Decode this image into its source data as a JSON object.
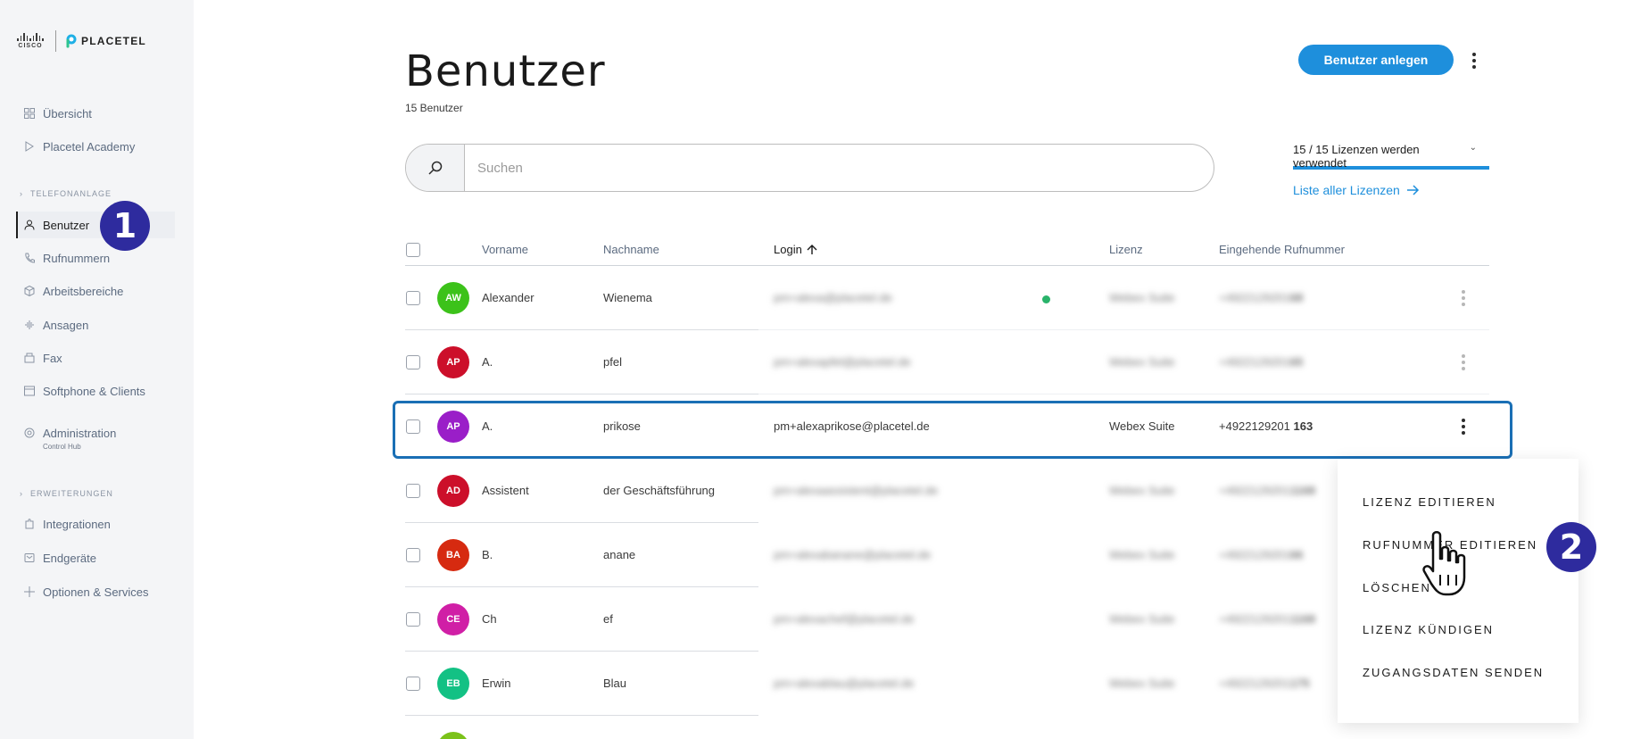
{
  "brand": {
    "cisco": "CISCO",
    "placetel": "PLACETEL"
  },
  "sidebar": {
    "items": [
      {
        "label": "Übersicht",
        "icon": "grid-icon"
      },
      {
        "label": "Placetel Academy",
        "icon": "play-icon"
      },
      {
        "label": "Benutzer",
        "icon": "user-icon"
      },
      {
        "label": "Rufnummern",
        "icon": "phone-icon"
      },
      {
        "label": "Arbeitsbereiche",
        "icon": "cube-icon"
      },
      {
        "label": "Ansagen",
        "icon": "waveform-icon"
      },
      {
        "label": "Fax",
        "icon": "fax-icon"
      },
      {
        "label": "Softphone & Clients",
        "icon": "window-icon"
      },
      {
        "label": "Administration",
        "icon": "gear-icon",
        "sub": "Control Hub"
      },
      {
        "label": "Integrationen",
        "icon": "puzzle-icon"
      },
      {
        "label": "Endgeräte",
        "icon": "device-icon"
      },
      {
        "label": "Optionen & Services",
        "icon": "plus-icon"
      }
    ],
    "sections": {
      "telefonanlage": "TELEFONANLAGE",
      "erweiterungen": "ERWEITERUNGEN"
    }
  },
  "annotations": {
    "step1": "1",
    "step2": "2"
  },
  "header": {
    "title": "Benutzer",
    "subtitle": "15 Benutzer",
    "create_button": "Benutzer anlegen"
  },
  "search": {
    "placeholder": "Suchen"
  },
  "licenses": {
    "usage": "15 / 15 Lizenzen werden verwendet",
    "link": "Liste aller Lizenzen"
  },
  "table": {
    "columns": {
      "vorname": "Vorname",
      "nachname": "Nachname",
      "login": "Login",
      "lizenz": "Lizenz",
      "rufnummer": "Eingehende Rufnummer"
    },
    "rows": [
      {
        "initials": "AW",
        "color": "#3cc21a",
        "vorname": "Alexander",
        "nachname": "Wienema",
        "login": "pm+alexa@placetel.de",
        "lizenz": "Webex Suite",
        "nummer": "+4922129201",
        "ext": "68"
      },
      {
        "initials": "AP",
        "color": "#cc0f2a",
        "vorname": "A.",
        "nachname": "pfel",
        "login": "pm+alexapfel@placetel.de",
        "lizenz": "Webex Suite",
        "nummer": "+4922129201",
        "ext": "65"
      },
      {
        "initials": "AP",
        "color": "#9a1ec8",
        "vorname": "A.",
        "nachname": "prikose",
        "login": "pm+alexaprikose@placetel.de",
        "lizenz": "Webex Suite",
        "nummer": "+4922129201",
        "ext": "163"
      },
      {
        "initials": "AD",
        "color": "#cc0f2a",
        "vorname": "Assistent",
        "nachname": "der Geschäftsführung",
        "login": "pm+alexaassistent@placetel.de",
        "lizenz": "Webex Suite",
        "nummer": "+4922129201",
        "ext": "1168"
      },
      {
        "initials": "BA",
        "color": "#d62a10",
        "vorname": "B.",
        "nachname": "anane",
        "login": "pm+alexabanane@placetel.de",
        "lizenz": "Webex Suite",
        "nummer": "+4922129201",
        "ext": "66"
      },
      {
        "initials": "CE",
        "color": "#d01fa6",
        "vorname": "Ch",
        "nachname": "ef",
        "login": "pm+alexachef@placetel.de",
        "lizenz": "Webex Suite",
        "nummer": "+4922129201",
        "ext": "1168"
      },
      {
        "initials": "EB",
        "color": "#13c184",
        "vorname": "Erwin",
        "nachname": "Blau",
        "login": "pm+alexablau@placetel.de",
        "lizenz": "Webex Suite",
        "nummer": "+4922129201",
        "ext": "175"
      }
    ]
  },
  "context_menu": {
    "items": [
      "LIZENZ EDITIEREN",
      "RUFNUMMER EDITIEREN",
      "LÖSCHEN",
      "LIZENZ KÜNDIGEN",
      "ZUGANGSDATEN SENDEN"
    ]
  },
  "colors": {
    "accent": "#1e8fdc",
    "badge": "#2e2b9e",
    "highlight": "#1a6fb5"
  }
}
